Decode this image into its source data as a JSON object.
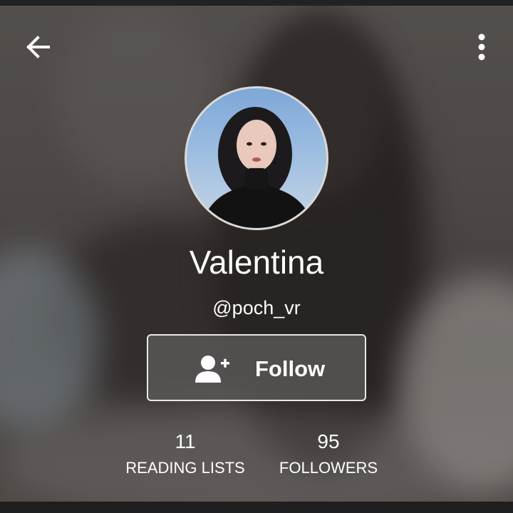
{
  "profile": {
    "display_name": "Valentina",
    "username": "@poch_vr"
  },
  "actions": {
    "follow_label": "Follow",
    "back_icon": "arrow-left-icon",
    "more_icon": "more-vertical-icon",
    "follow_icon": "add-user-icon"
  },
  "stats": [
    {
      "value": "11",
      "label": "READING LISTS"
    },
    {
      "value": "95",
      "label": "FOLLOWERS"
    }
  ],
  "colors": {
    "text": "#ffffff",
    "button_border": "#e8e8e8",
    "avatar_border": "#d9d9d9"
  }
}
